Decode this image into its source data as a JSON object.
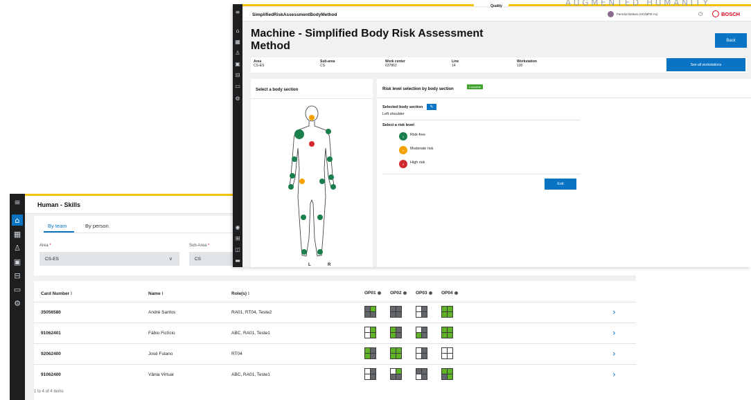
{
  "watermark": "AUGMENTED HUMANITY",
  "skills": {
    "title": "Human - Skills",
    "tabs": [
      {
        "label": "By team"
      },
      {
        "label": "By person"
      }
    ],
    "area": {
      "label": "Area",
      "value": "CS-ES"
    },
    "subarea": {
      "label": "Sub-Area",
      "value": "CS"
    },
    "columns": {
      "card": "Card Number ⁝",
      "name": "Name ⁝",
      "roles": "Role(s) ⁝",
      "op01": "OP01",
      "op02": "OP02",
      "op03": "OP03",
      "op04": "OP04"
    },
    "rows": [
      {
        "card": "35056580",
        "name": "André Santos",
        "roles": "RA01, RT04, Teste2",
        "skills": [
          [
            "k",
            "g",
            "k",
            "k"
          ],
          [
            "k",
            "k",
            "k",
            "k"
          ],
          [
            "w",
            "k",
            "w",
            "k"
          ],
          [
            "g",
            "g",
            "g",
            "g"
          ]
        ]
      },
      {
        "card": "91062401",
        "name": "Fábio Fictício",
        "roles": "ABC, RA01, Teste1",
        "skills": [
          [
            "w",
            "g",
            "w",
            "g"
          ],
          [
            "g",
            "k",
            "g",
            "k"
          ],
          [
            "w",
            "k",
            "g",
            "k"
          ],
          [
            "g",
            "g",
            "g",
            "g"
          ]
        ]
      },
      {
        "card": "92062400",
        "name": "José Fulano",
        "roles": "RT04",
        "skills": [
          [
            "g",
            "k",
            "g",
            "k"
          ],
          [
            "g",
            "g",
            "g",
            "g"
          ],
          [
            "w",
            "k",
            "w",
            "k"
          ],
          [
            "w",
            "w",
            "w",
            "w"
          ]
        ]
      },
      {
        "card": "91062400",
        "name": "Vânia Virtual",
        "roles": "ABC, RA01, Teste1",
        "skills": [
          [
            "w",
            "k",
            "w",
            "k"
          ],
          [
            "w",
            "g",
            "k",
            "k"
          ],
          [
            "k",
            "k",
            "w",
            "k"
          ],
          [
            "g",
            "g",
            "k",
            "g"
          ]
        ]
      }
    ],
    "footer": "1 to 4 of 4 items"
  },
  "risk": {
    "app_title": "SimplifiedRiskAssessmentBodyMethod",
    "top_label": "Quality",
    "user": "Ferreira Nelson (HC/MFD-Ax)",
    "brand": "BOSCH",
    "title": "Machine - Simplified Body Risk Assessment Method",
    "back_label": "Back",
    "info": {
      "area": {
        "label": "Area",
        "value": "CS-ES"
      },
      "subarea": {
        "label": "Sub-area",
        "value": "CS"
      },
      "workcenter": {
        "label": "Work center",
        "value": "637863"
      },
      "line": {
        "label": "Line",
        "value": "14"
      },
      "workstation": {
        "label": "Workstation",
        "value": "130"
      },
      "see_all": "See all workstations"
    },
    "body_panel_title": "Select a body section",
    "left_label": "L",
    "right_label": "R",
    "level_title": "Risk level selection by body section",
    "complete": "Complete",
    "selected_label": "Selected body section",
    "selected_value": "Left shoulder",
    "select_risk_label": "Select a risk level",
    "levels": [
      {
        "label": "Risk-free",
        "num": "1",
        "color": "#1a7f4b"
      },
      {
        "label": "Moderate risk",
        "num": "2",
        "color": "#f5a100"
      },
      {
        "label": "High risk",
        "num": "3",
        "color": "#d0282e"
      }
    ],
    "exit_label": "Exit"
  }
}
